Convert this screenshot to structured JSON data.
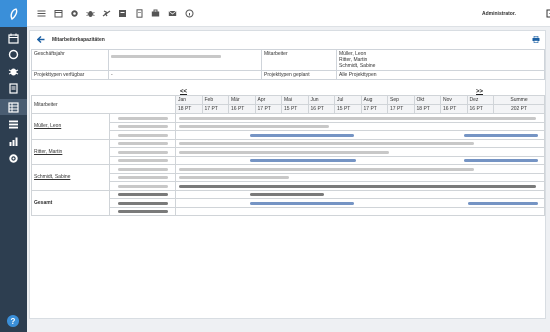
{
  "topbar": {
    "user_label": "Administrator.",
    "icons": [
      "menu-icon",
      "calendar-icon",
      "settings-icon",
      "bug-icon",
      "flight-icon",
      "report-icon",
      "document-icon",
      "briefcase-icon",
      "mail-icon",
      "info-icon"
    ]
  },
  "sidebar": {
    "icons": [
      "logo-icon",
      "calendar-icon",
      "refresh-icon",
      "bug-icon",
      "document-icon",
      "table-icon",
      "list-icon",
      "chart-icon",
      "gear-icon"
    ],
    "help_label": "?"
  },
  "panel": {
    "title": "Mitarbeiterkapazitäten"
  },
  "info": {
    "geschaeftsjahr_label": "Geschäftsjahr",
    "mitarbeiter_label": "Mitarbeiter",
    "mitarbeiter_values": [
      "Müller, Leon",
      "Ritter, Martin",
      "Schmidt, Sabine"
    ],
    "projekttypen_verfuegbar_label": "Projekttypen verfügbar",
    "projekttypen_verfuegbar_value": "-",
    "projekttypen_geplant_label": "Projekttypen geplant",
    "projekttypen_geplant_value": "Alle Projekttypen"
  },
  "nav": {
    "prev": "<<",
    "next": ">>"
  },
  "grid": {
    "mitarbeiter_header": "Mitarbeiter",
    "months": [
      {
        "name": "Jan",
        "pt": "18 PT"
      },
      {
        "name": "Feb",
        "pt": "17 PT"
      },
      {
        "name": "Mär",
        "pt": "16 PT"
      },
      {
        "name": "Apr",
        "pt": "17 PT"
      },
      {
        "name": "Mai",
        "pt": "15 PT"
      },
      {
        "name": "Jun",
        "pt": "16 PT"
      },
      {
        "name": "Jul",
        "pt": "15 PT"
      },
      {
        "name": "Aug",
        "pt": "17 PT"
      },
      {
        "name": "Sep",
        "pt": "17 PT"
      },
      {
        "name": "Okt",
        "pt": "18 PT"
      },
      {
        "name": "Nov",
        "pt": "16 PT"
      },
      {
        "name": "Dez",
        "pt": "16 PT"
      }
    ],
    "summe_label": "Summe",
    "summe_pt": "202 PT",
    "employees": [
      {
        "name": "Müller, Leon"
      },
      {
        "name": "Ritter, Martin"
      },
      {
        "name": "Schmidt, Sabine"
      }
    ],
    "gesamt_label": "Gesamt"
  },
  "colors": {
    "sidebar": "#2d3e50",
    "accent": "#3a8fd9",
    "bar_gray": "#c8c8c8",
    "bar_blue": "#7594c4",
    "bar_dark": "#7a7a7a"
  }
}
